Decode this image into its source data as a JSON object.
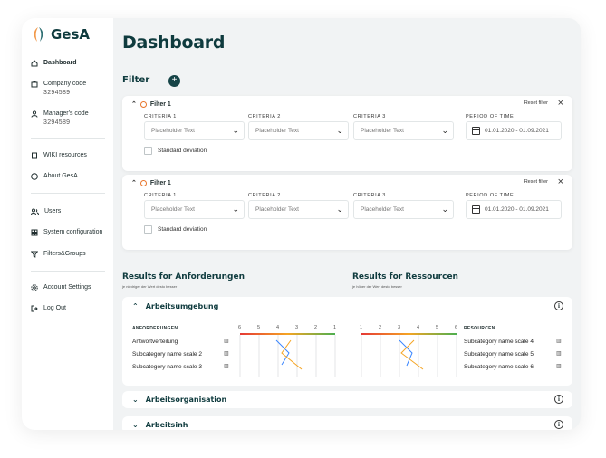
{
  "app": {
    "name": "GesA"
  },
  "sidebar": {
    "dashboard": "Dashboard",
    "company_code_label": "Company code",
    "company_code_value": "3294589",
    "manager_code_label": "Manager's code",
    "manager_code_value": "3294589",
    "wiki": "WIKI resources",
    "about": "About GesA",
    "users": "Users",
    "system_config": "System configuration",
    "filters_groups": "Filters&Groups",
    "account_settings": "Account Settings",
    "logout": "Log Out"
  },
  "page": {
    "title": "Dashboard",
    "filter_heading": "Filter"
  },
  "filters": [
    {
      "title": "Filter 1",
      "reset": "Reset filter",
      "criteria1_label": "CRITERIA 1",
      "criteria2_label": "CRITERIA 2",
      "criteria3_label": "CRITERIA 3",
      "period_label": "PERIOD OF TIME",
      "criteria1_value": "Placeholder Text",
      "criteria2_value": "Placeholder Text",
      "criteria3_value": "Placeholder Text",
      "period_value": "01.01.2020 - 01.09.2021",
      "std_dev": "Standard deviation"
    },
    {
      "title": "Filter 1",
      "reset": "Reset filter",
      "criteria1_label": "CRITERIA 1",
      "criteria2_label": "CRITERIA 2",
      "criteria3_label": "CRITERIA 3",
      "period_label": "PERIOD OF TIME",
      "criteria1_value": "Placeholder Text",
      "criteria2_value": "Placeholder Text",
      "criteria3_value": "Placeholder Text",
      "period_value": "01.01.2020 - 01.09.2021",
      "std_dev": "Standard deviation"
    }
  ],
  "results": {
    "left_title": "Results for Anforderungen",
    "left_sub": "je niedriger der Wert desto besser",
    "right_title": "Results for Ressourcen",
    "right_sub": "je höher der Wert desto besser"
  },
  "sections": [
    {
      "title": "Arbeitsumgebung",
      "expanded": true
    },
    {
      "title": "Arbeitsorganisation",
      "expanded": false
    },
    {
      "title": "Arbeitsinh",
      "expanded": false
    }
  ],
  "arbeitsumgebung": {
    "left_header": "ANFORDERUNGEN",
    "right_header": "RESOURCEN",
    "left_scale": [
      "6",
      "5",
      "4",
      "3",
      "2",
      "1"
    ],
    "right_scale": [
      "1",
      "2",
      "3",
      "4",
      "5",
      "6"
    ],
    "left_rows": [
      "Antwortverteilung",
      "Subcategory name scale 2",
      "Subcategory name scale 3"
    ],
    "right_rows": [
      "Subcategory name scale 4",
      "Subcategory name scale 5",
      "Subcategory name scale 6"
    ]
  },
  "colors": {
    "brand_dark": "#0f3b3e",
    "accent_orange": "#e8752b",
    "line_blue": "#3a86ff",
    "line_orange": "#f5a524",
    "scale_red": "#e53935",
    "scale_green": "#4caf50"
  }
}
